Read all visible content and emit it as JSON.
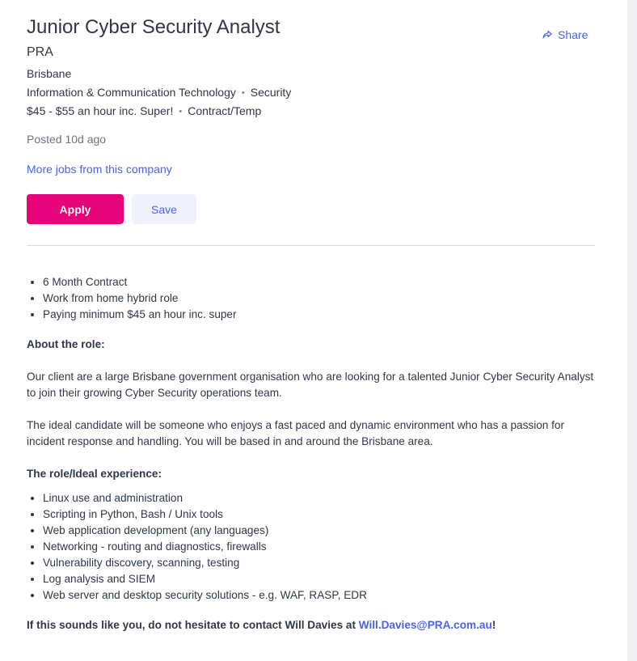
{
  "job": {
    "title": "Junior Cyber Security Analyst",
    "company": "PRA",
    "location": "Brisbane",
    "classification": "Information & Communication Technology",
    "subclassification": "Security",
    "salary": "$45 - $55 an hour inc. Super!",
    "work_type": "Contract/Temp",
    "posted": "Posted 10d ago",
    "more_jobs_label": "More jobs from this company",
    "separator": "•"
  },
  "actions": {
    "share_label": "Share",
    "apply_label": "Apply",
    "save_label": "Save"
  },
  "description": {
    "highlights": [
      "6 Month Contract",
      "Work from home hybrid role",
      "Paying minimum $45 an hour inc. super"
    ],
    "about_heading": "About the role:",
    "about_p1": "Our client are a large Brisbane government organisation who are looking for a talented Junior Cyber Security Analyst to join their growing Cyber Security operations team.",
    "about_p2": "The ideal candidate will be someone who enjoys a fast paced and dynamic environment who has a passion for incident response and handling. You will be based in and around the Brisbane area.",
    "experience_heading": "The role/Ideal experience:",
    "experience": [
      "Linux use and administration",
      "Scripting in Python, Bash / Unix tools",
      "Web application development (any languages)",
      "Networking - routing and diagnostics, firewalls",
      "Vulnerability discovery, scanning, testing",
      "Log analysis and SIEM",
      "Web server and desktop security solutions - e.g. WAF, RASP, EDR"
    ],
    "cta_text": "If this sounds like you, do not hesitate to contact Will Davies at ",
    "cta_email": "Will.Davies@PRA.com.au",
    "cta_end": "!"
  },
  "colors": {
    "apply_bg": "#e60278",
    "link": "#4964e9",
    "save_bg": "#f0f2fc"
  },
  "icons": {
    "share": "share-icon"
  }
}
